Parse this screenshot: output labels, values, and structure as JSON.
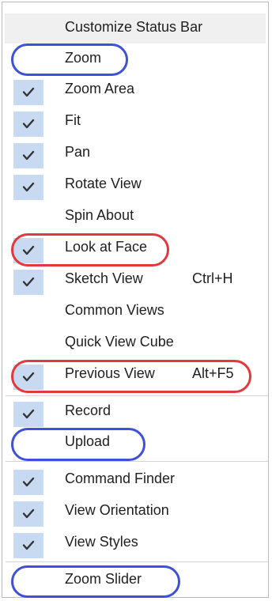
{
  "menu": {
    "items": [
      {
        "label": "Customize Status Bar",
        "checked": false,
        "shortcut": ""
      },
      {
        "label": "Zoom",
        "checked": false,
        "shortcut": ""
      },
      {
        "label": "Zoom Area",
        "checked": true,
        "shortcut": ""
      },
      {
        "label": "Fit",
        "checked": true,
        "shortcut": ""
      },
      {
        "label": "Pan",
        "checked": true,
        "shortcut": ""
      },
      {
        "label": "Rotate View",
        "checked": true,
        "shortcut": ""
      },
      {
        "label": "Spin About",
        "checked": false,
        "shortcut": ""
      },
      {
        "label": "Look at Face",
        "checked": true,
        "shortcut": ""
      },
      {
        "label": "Sketch View",
        "checked": true,
        "shortcut": "Ctrl+H"
      },
      {
        "label": "Common Views",
        "checked": false,
        "shortcut": ""
      },
      {
        "label": "Quick View Cube",
        "checked": false,
        "shortcut": ""
      },
      {
        "label": "Previous View",
        "checked": true,
        "shortcut": "Alt+F5"
      },
      {
        "label": "Record",
        "checked": true,
        "shortcut": ""
      },
      {
        "label": "Upload",
        "checked": false,
        "shortcut": ""
      },
      {
        "label": "Command Finder",
        "checked": true,
        "shortcut": ""
      },
      {
        "label": "View Orientation",
        "checked": true,
        "shortcut": ""
      },
      {
        "label": "View Styles",
        "checked": true,
        "shortcut": ""
      },
      {
        "label": "Zoom Slider",
        "checked": false,
        "shortcut": ""
      }
    ]
  },
  "colors": {
    "blue_highlight": "#3f51d8",
    "red_highlight": "#e0393e",
    "check_background": "#c8d9f2",
    "header_background": "#f0f0f0"
  },
  "icons": {
    "check": "checkmark-icon"
  }
}
